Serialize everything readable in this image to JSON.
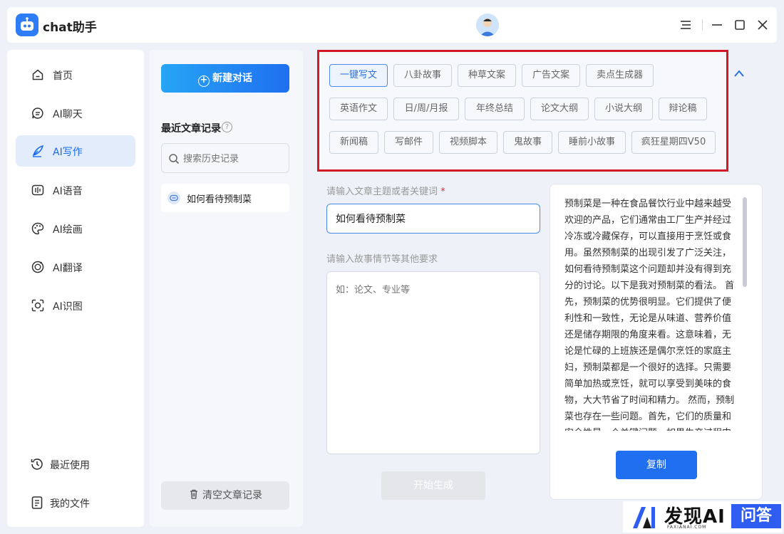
{
  "app": {
    "title": "chat助手"
  },
  "nav": {
    "items": [
      {
        "label": "首页",
        "icon": "home-icon"
      },
      {
        "label": "AI聊天",
        "icon": "chat-icon"
      },
      {
        "label": "AI写作",
        "icon": "pen-icon",
        "active": true
      },
      {
        "label": "AI语音",
        "icon": "voice-icon"
      },
      {
        "label": "AI绘画",
        "icon": "palette-icon"
      },
      {
        "label": "AI翻译",
        "icon": "translate-icon"
      },
      {
        "label": "AI识图",
        "icon": "scan-icon"
      }
    ],
    "bottom": [
      {
        "label": "最近使用",
        "icon": "history-icon"
      },
      {
        "label": "我的文件",
        "icon": "file-icon"
      }
    ]
  },
  "history": {
    "new_chat": "新建对话",
    "title": "最近文章记录",
    "search_placeholder": "搜索历史记录",
    "items": [
      "如何看待预制菜"
    ],
    "clear": "清空文章记录"
  },
  "tags": [
    "一键写文",
    "八卦故事",
    "种草文案",
    "广告文案",
    "卖点生成器",
    "英语作文",
    "日/周/月报",
    "年终总结",
    "论文大纲",
    "小说大纲",
    "辩论稿",
    "新闻稿",
    "写邮件",
    "视频脚本",
    "鬼故事",
    "睡前小故事",
    "疯狂星期四V50"
  ],
  "active_tag": "一键写文",
  "form": {
    "topic_label": "请输入文章主题或者关键词",
    "required_mark": "*",
    "topic_value": "如何看待预制菜",
    "extra_label": "请输入故事情节等其他要求",
    "extra_placeholder": "如：论文、专业等",
    "generate": "开始生成"
  },
  "result": {
    "text": "预制菜是一种在食品餐饮行业中越来越受欢迎的产品，它们通常由工厂生产并经过冷冻或冷藏保存，可以直接用于烹饪或食用。虽然预制菜的出现引发了广泛关注，如何看待预制菜这个问题却并没有得到充分的讨论。以下是我对预制菜的看法。 首先，预制菜的优势很明显。它们提供了便利性和一致性，无论是从味道、营养价值还是储存期限的角度来看。这意味着，无论是忙碌的上班族还是偶尔烹饪的家庭主妇，预制菜都是一个很好的选择。只需要简单加热或烹饪，就可以享受到美味的食物，大大节省了时间和精力。 然而，预制菜也存在一些问题。首先，它们的质量和安全性是一个关键问题。如果生产过程中的",
    "copy": "复制"
  },
  "watermark": {
    "brand": "发现AI",
    "url": "FAXIANAI.COM",
    "badge": "问答"
  },
  "colors": {
    "accent": "#1f6ff0",
    "highlight_border": "#d21a26",
    "active_nav_bg": "#e3ecfa"
  }
}
